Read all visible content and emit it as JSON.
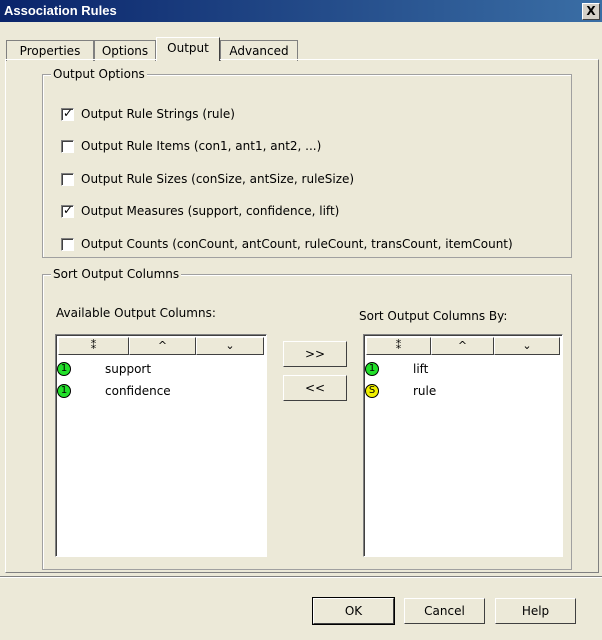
{
  "window": {
    "title": "Association Rules",
    "close_label": "X"
  },
  "tabs": [
    {
      "label": "Properties"
    },
    {
      "label": "Options"
    },
    {
      "label": "Output"
    },
    {
      "label": "Advanced"
    }
  ],
  "output_options": {
    "legend": "Output Options",
    "items": [
      {
        "label": "Output Rule Strings (rule)",
        "checked": true
      },
      {
        "label": "Output Rule Items (con1, ant1, ant2, ...)",
        "checked": false
      },
      {
        "label": "Output Rule Sizes (conSize, antSize, ruleSize)",
        "checked": false
      },
      {
        "label": "Output Measures (support, confidence, lift)",
        "checked": true
      },
      {
        "label": "Output Counts (conCount, antCount, ruleCount, transCount, itemCount)",
        "checked": false
      }
    ]
  },
  "sort_output": {
    "legend": "Sort Output Columns",
    "available_label": "Available Output Columns:",
    "sort_by_label": "Sort Output Columns By:",
    "header_buttons": [
      "⁑",
      "^",
      "⌄"
    ],
    "available": [
      {
        "badge": "1",
        "name": "support"
      },
      {
        "badge": "1",
        "name": "confidence"
      }
    ],
    "sort_by": [
      {
        "badge": "1",
        "name": "lift"
      },
      {
        "badge": "S",
        "name": "rule"
      }
    ],
    "add_label": ">>",
    "remove_label": "<<"
  },
  "footer": {
    "ok": "OK",
    "cancel": "Cancel",
    "help": "Help"
  },
  "colors": {
    "numeric_badge": "#22e02a",
    "string_badge": "#f0f000"
  }
}
